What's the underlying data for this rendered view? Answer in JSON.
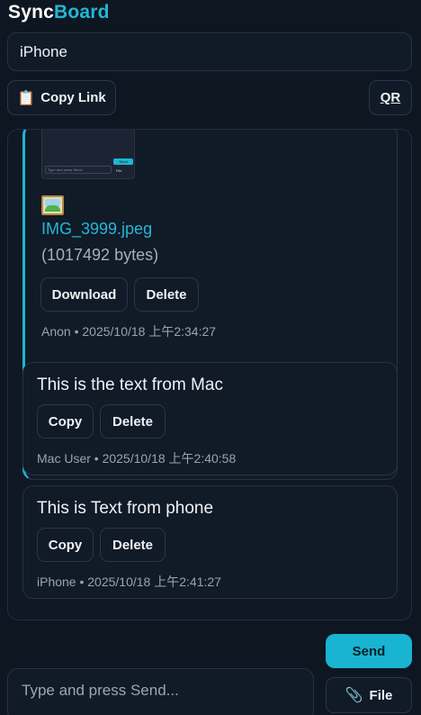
{
  "app": {
    "brand_part1": "Sync",
    "brand_part2": "Board",
    "brand_color": "#22b8d6"
  },
  "room": {
    "value": "iPhone"
  },
  "toolbar": {
    "copy_link_icon": "clipboard-icon",
    "copy_link_label": "Copy Link",
    "qr_label": "QR"
  },
  "thumbnail": {
    "placeholder": "Type and press Send...",
    "send_label": "Send",
    "file_label": "File"
  },
  "feed": {
    "items": [
      {
        "kind": "file",
        "icon": "image-file-icon",
        "file_name": "IMG_3999.jpeg",
        "file_size": "(1017492 bytes)",
        "download_label": "Download",
        "delete_label": "Delete",
        "author": "Anon",
        "timestamp": "2025/10/18 上午2:34:27",
        "meta": "Anon • 2025/10/18 上午2:34:27"
      },
      {
        "kind": "text",
        "text": "This is the text from Mac",
        "copy_label": "Copy",
        "delete_label": "Delete",
        "author": "Mac User",
        "timestamp": "2025/10/18 上午2:40:58",
        "meta": "Mac User • 2025/10/18 上午2:40:58"
      },
      {
        "kind": "text",
        "text": "This is Text from phone",
        "copy_label": "Copy",
        "delete_label": "Delete",
        "author": "iPhone",
        "timestamp": "2025/10/18 上午2:41:27",
        "meta": "iPhone • 2025/10/18 上午2:41:27"
      }
    ]
  },
  "composer": {
    "placeholder": "Type and press Send...",
    "value": "",
    "send_label": "Send",
    "file_icon": "paperclip-icon",
    "file_label": "File"
  },
  "colors": {
    "background": "#0e1622",
    "accent": "#1fb6d4"
  }
}
